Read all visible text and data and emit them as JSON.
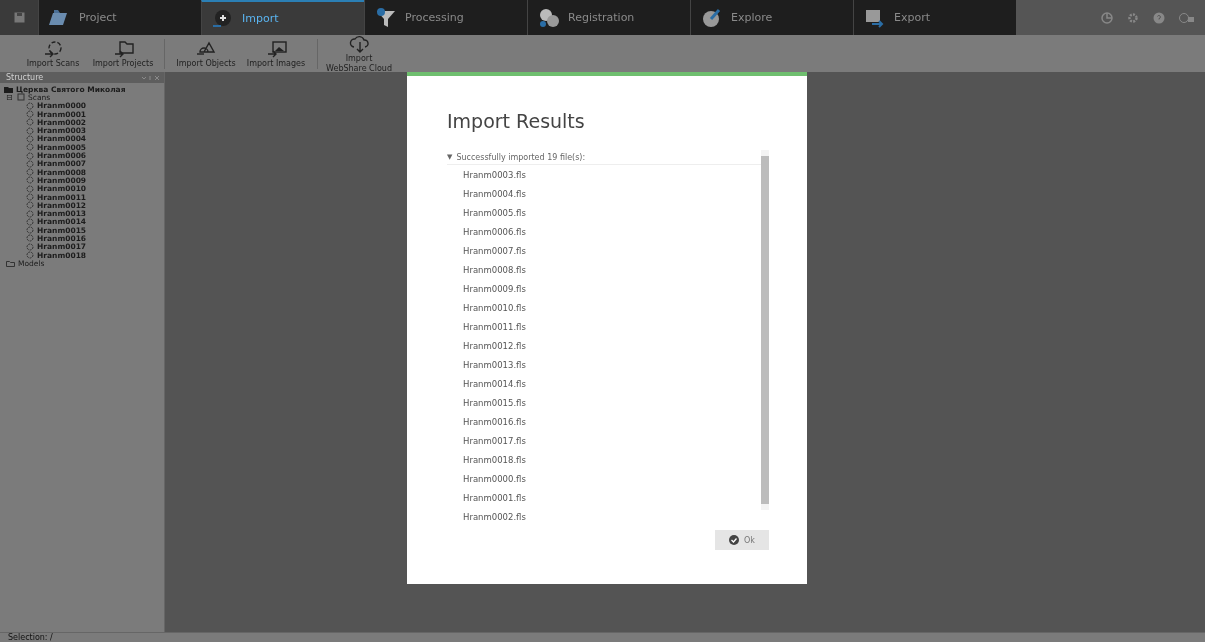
{
  "tabs": [
    {
      "label": "Project",
      "selected": false
    },
    {
      "label": "Import",
      "selected": true
    },
    {
      "label": "Processing",
      "selected": false
    },
    {
      "label": "Registration",
      "selected": false
    },
    {
      "label": "Explore",
      "selected": false
    },
    {
      "label": "Export",
      "selected": false
    }
  ],
  "toolbar": [
    {
      "kind": "button",
      "label": "Import Scans"
    },
    {
      "kind": "button",
      "label": "Import Projects"
    },
    {
      "kind": "separator"
    },
    {
      "kind": "button",
      "label": "Import Objects"
    },
    {
      "kind": "button",
      "label": "Import Images"
    },
    {
      "kind": "separator"
    },
    {
      "kind": "button",
      "label": "Import WebShare Cloud"
    }
  ],
  "structure": {
    "title": "Structure",
    "items": [
      {
        "label": "Церква Святого Миколая",
        "kind": "project",
        "children": [
          {
            "label": "Scans",
            "kind": "scans",
            "toggle": "⊟",
            "expanded": true,
            "children": [
              {
                "label": "Hranm0000",
                "kind": "scan"
              },
              {
                "label": "Hranm0001",
                "kind": "scan"
              },
              {
                "label": "Hranm0002",
                "kind": "scan"
              },
              {
                "label": "Hranm0003",
                "kind": "scan"
              },
              {
                "label": "Hranm0004",
                "kind": "scan"
              },
              {
                "label": "Hranm0005",
                "kind": "scan"
              },
              {
                "label": "Hranm0006",
                "kind": "scan"
              },
              {
                "label": "Hranm0007",
                "kind": "scan"
              },
              {
                "label": "Hranm0008",
                "kind": "scan"
              },
              {
                "label": "Hranm0009",
                "kind": "scan"
              },
              {
                "label": "Hranm0010",
                "kind": "scan"
              },
              {
                "label": "Hranm0011",
                "kind": "scan"
              },
              {
                "label": "Hranm0012",
                "kind": "scan"
              },
              {
                "label": "Hranm0013",
                "kind": "scan"
              },
              {
                "label": "Hranm0014",
                "kind": "scan"
              },
              {
                "label": "Hranm0015",
                "kind": "scan"
              },
              {
                "label": "Hranm0016",
                "kind": "scan"
              },
              {
                "label": "Hranm0017",
                "kind": "scan"
              },
              {
                "label": "Hranm0018",
                "kind": "scan"
              }
            ]
          },
          {
            "label": "Models",
            "kind": "models"
          }
        ]
      }
    ]
  },
  "dialog": {
    "title": "Import Results",
    "toggle": "▼",
    "section": "Successfully imported 19 file(s):",
    "expanded": true,
    "files": [
      "Hranm0003.fls",
      "Hranm0004.fls",
      "Hranm0005.fls",
      "Hranm0006.fls",
      "Hranm0007.fls",
      "Hranm0008.fls",
      "Hranm0009.fls",
      "Hranm0010.fls",
      "Hranm0011.fls",
      "Hranm0012.fls",
      "Hranm0013.fls",
      "Hranm0014.fls",
      "Hranm0015.fls",
      "Hranm0016.fls",
      "Hranm0017.fls",
      "Hranm0018.fls",
      "Hranm0000.fls",
      "Hranm0001.fls",
      "Hranm0002.fls"
    ],
    "ok": "Ok"
  },
  "status_bar": "Selection: /"
}
